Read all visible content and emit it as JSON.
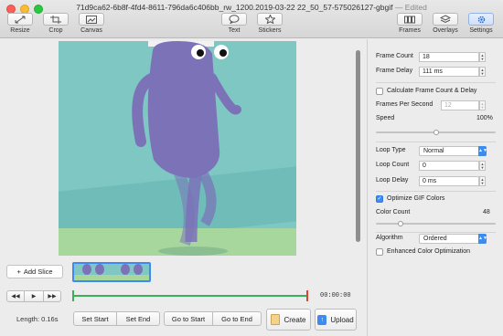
{
  "window": {
    "title": "71d9ca62-6b8f-4fd4-8611-796da6c406bb_rw_1200.2019-03-22 22_50_57-575026127-gbgif",
    "edited": "— Edited",
    "toolbar_left": [
      {
        "label": "Resize",
        "icon": "resize-icon"
      },
      {
        "label": "Crop",
        "icon": "crop-icon"
      },
      {
        "label": "Canvas",
        "icon": "canvas-icon"
      }
    ],
    "toolbar_center": [
      {
        "label": "Text",
        "icon": "speech-bubble-icon"
      },
      {
        "label": "Stickers",
        "icon": "star-icon"
      }
    ],
    "toolbar_right": [
      {
        "label": "Frames",
        "icon": "frames-icon"
      },
      {
        "label": "Overlays",
        "icon": "layers-icon"
      },
      {
        "label": "Settings",
        "icon": "gear-icon"
      }
    ]
  },
  "slices": {
    "add_label": "Add Slice"
  },
  "timeline": {
    "time": "00:00:00"
  },
  "bottom": {
    "length": "Length: 0.16s",
    "set_start": "Set Start",
    "set_end": "Set End",
    "go_start": "Go to Start",
    "go_end": "Go to End",
    "create": "Create",
    "upload": "Upload"
  },
  "settings": {
    "frame_count_label": "Frame Count",
    "frame_count": "18",
    "frame_delay_label": "Frame Delay",
    "frame_delay": "111 ms",
    "calc_label": "Calculate Frame Count & Delay",
    "fps_label": "Frames Per Second",
    "fps": "12",
    "speed_label": "Speed",
    "speed_value": "100%",
    "speed_level": 0.5,
    "loop_type_label": "Loop Type",
    "loop_type": "Normal",
    "loop_count_label": "Loop Count",
    "loop_count": "0",
    "loop_delay_label": "Loop Delay",
    "loop_delay": "0 ms",
    "optimize_label": "Optimize GIF Colors",
    "color_count_label": "Color Count",
    "color_count": "48",
    "color_level": 0.19,
    "algorithm_label": "Algorithm",
    "algorithm": "Ordered",
    "enhanced_label": "Enhanced Color Optimization"
  },
  "colors": {
    "accent": "#3d8bf0",
    "scene_bg": "#7ec7c3",
    "ground": "#a8d79e",
    "character": "#7b72b8",
    "start_marker": "#3cae5d",
    "end_marker": "#e0442f"
  }
}
